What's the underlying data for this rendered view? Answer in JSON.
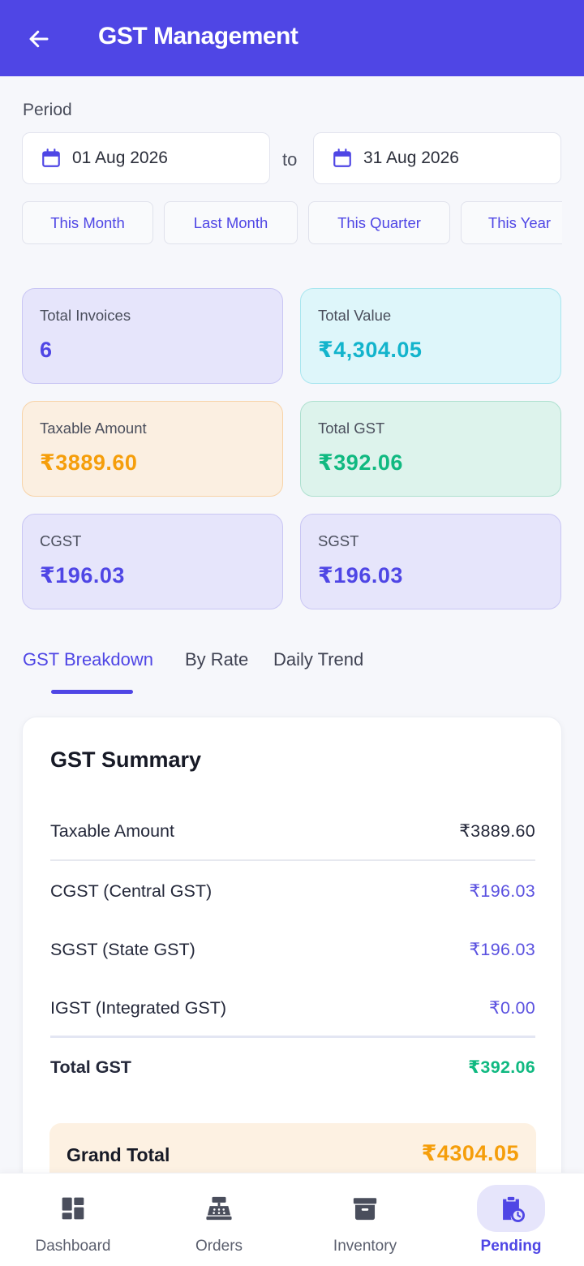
{
  "header": {
    "title": "GST Management"
  },
  "period": {
    "label": "Period",
    "from": "01 Aug 2026",
    "to_label": "to",
    "to": "31 Aug 2026",
    "quick_ranges": [
      "This Month",
      "Last Month",
      "This Quarter",
      "This Year"
    ]
  },
  "stats": {
    "total_invoices": {
      "label": "Total Invoices",
      "value": "6"
    },
    "total_value": {
      "label": "Total Value",
      "value": "₹4,304.05"
    },
    "taxable_amount": {
      "label": "Taxable Amount",
      "value": "₹3889.60"
    },
    "total_gst": {
      "label": "Total GST",
      "value": "₹392.06"
    },
    "cgst": {
      "label": "CGST",
      "value": "₹196.03"
    },
    "sgst": {
      "label": "SGST",
      "value": "₹196.03"
    }
  },
  "tabs": [
    "GST Breakdown",
    "By Rate",
    "Daily Trend"
  ],
  "active_tab": "GST Breakdown",
  "summary": {
    "title": "GST Summary",
    "rows": [
      {
        "name": "Taxable Amount",
        "amount": "₹3889.60"
      },
      {
        "name": "CGST (Central GST)",
        "amount": "₹196.03"
      },
      {
        "name": "SGST (State GST)",
        "amount": "₹196.03"
      },
      {
        "name": "IGST (Integrated GST)",
        "amount": "₹0.00"
      },
      {
        "name": "Total GST",
        "amount": "₹392.06"
      }
    ],
    "grand_total": {
      "name": "Grand Total",
      "amount": "₹4304.05"
    }
  },
  "bottom_nav": [
    {
      "label": "Dashboard",
      "icon": "dashboard-icon"
    },
    {
      "label": "Orders",
      "icon": "cash-register-icon"
    },
    {
      "label": "Inventory",
      "icon": "archive-box-icon"
    },
    {
      "label": "Pending",
      "icon": "clipboard-clock-icon",
      "active": true
    }
  ],
  "colors": {
    "primary": "#4f46e5",
    "cyan": "#13b4cc",
    "orange": "#f59e0b",
    "green": "#10b981"
  }
}
